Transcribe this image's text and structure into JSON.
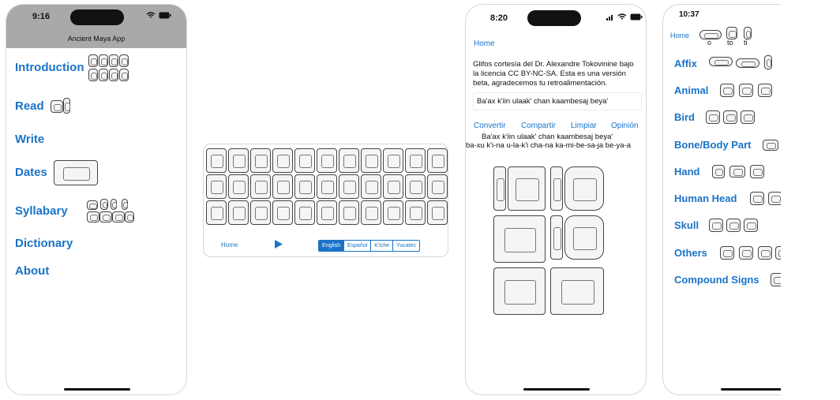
{
  "screen1": {
    "time": "9:16",
    "title": "Ancient Maya App",
    "menu": [
      "Introduction",
      "Read",
      "Write",
      "Dates",
      "Syllabary",
      "Dictionary",
      "About"
    ]
  },
  "screen2": {
    "home": "Home",
    "play_icon": "play-icon",
    "languages": [
      "English",
      "Español",
      "K'iche",
      "Yucatec"
    ],
    "selected_language": "English"
  },
  "screen3": {
    "time": "8:20",
    "home": "Home",
    "credit": "Glifos cortesía del Dr. Alexandre Tokovinine bajo la licencia CC BY-NC-SA. Esta es una versión beta, agradecemos tu retroalimentación.",
    "input_value": "Ba'ax k'iin ulaak' chan kaambesaj beya'",
    "actions": [
      "Convertir",
      "Compartir",
      "Limpiar",
      "Opinión"
    ],
    "output_text": "Ba'ax k'iin ulaak' chan kaambesaj beya'",
    "syllables": "ba-xu k'i-na u-la-k'i cha-na ka-mi-be-sa-ja be-ya-a"
  },
  "screen4": {
    "time": "10:37",
    "home": "Home",
    "affix_labels": [
      "o",
      "to",
      "ti"
    ],
    "categories": [
      "Affix",
      "Animal",
      "Bird",
      "Bone/Body Part",
      "Hand",
      "Human Head",
      "Skull",
      "Others",
      "Compound Signs"
    ]
  }
}
